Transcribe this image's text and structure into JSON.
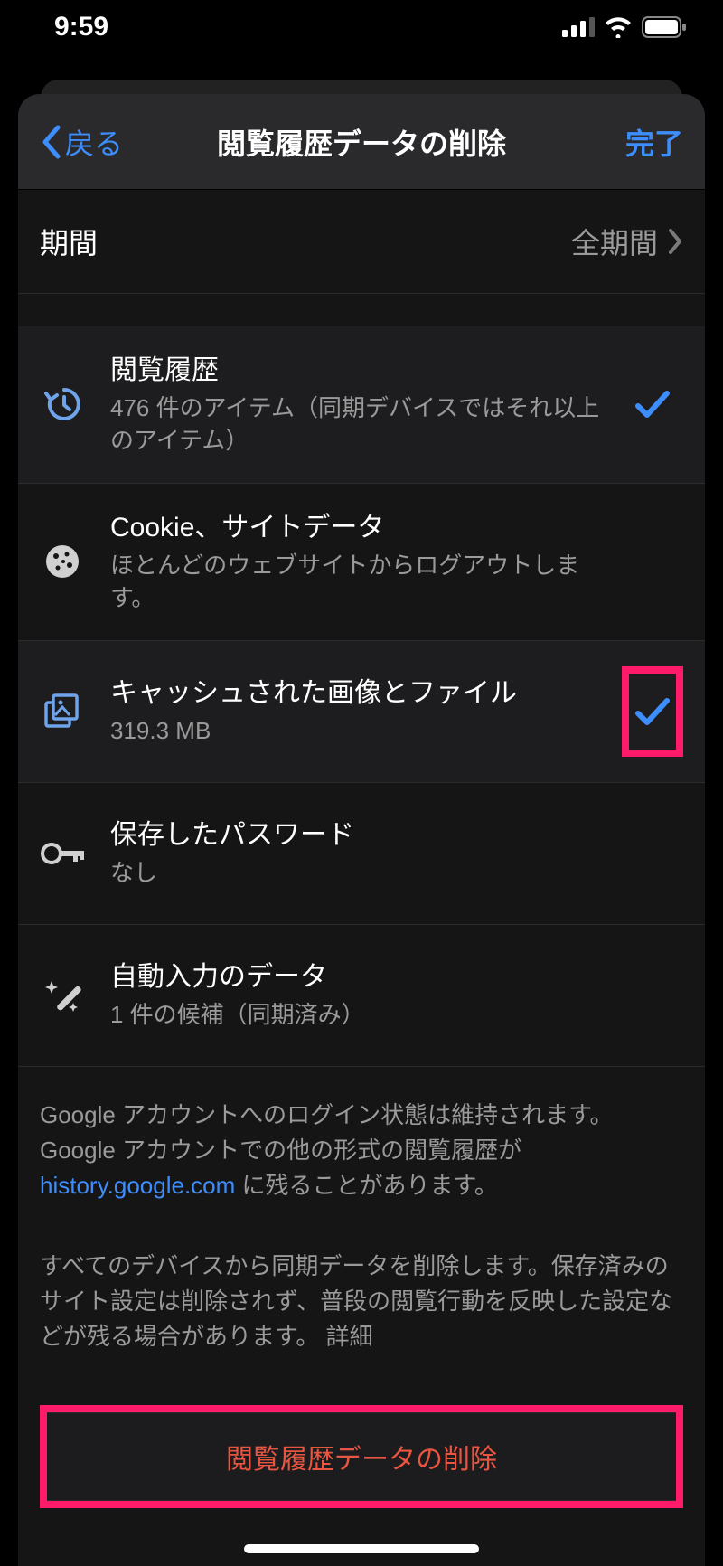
{
  "status": {
    "time": "9:59"
  },
  "nav": {
    "back": "戻る",
    "title": "閲覧履歴データの削除",
    "done": "完了"
  },
  "period": {
    "label": "期間",
    "value": "全期間"
  },
  "items": [
    {
      "title": "閲覧履歴",
      "sub": "476 件のアイテム（同期デバイスではそれ以上のアイテム）",
      "checked": true,
      "highlight": false
    },
    {
      "title": "Cookie、サイトデータ",
      "sub": "ほとんどのウェブサイトからログアウトします。",
      "checked": false,
      "highlight": false
    },
    {
      "title": "キャッシュされた画像とファイル",
      "sub": "319.3 MB",
      "checked": true,
      "highlight": true
    },
    {
      "title": "保存したパスワード",
      "sub": "なし",
      "checked": false,
      "highlight": false
    },
    {
      "title": "自動入力のデータ",
      "sub": "1 件の候補（同期済み）",
      "checked": false,
      "highlight": false
    }
  ],
  "info": {
    "text1a": "Google アカウントへのログイン状態は維持されます。Google アカウントでの他の形式の閲覧履歴が ",
    "link1": "history.google.com",
    "text1b": " に残ることがあります。",
    "text2a": "すべてのデバイスから同期データを削除します。保存済みのサイト設定は削除されず、普段の閲覧行動を反映した設定などが残る場合があります。",
    "link2": "詳細"
  },
  "clear_button": "閲覧履歴データの削除"
}
